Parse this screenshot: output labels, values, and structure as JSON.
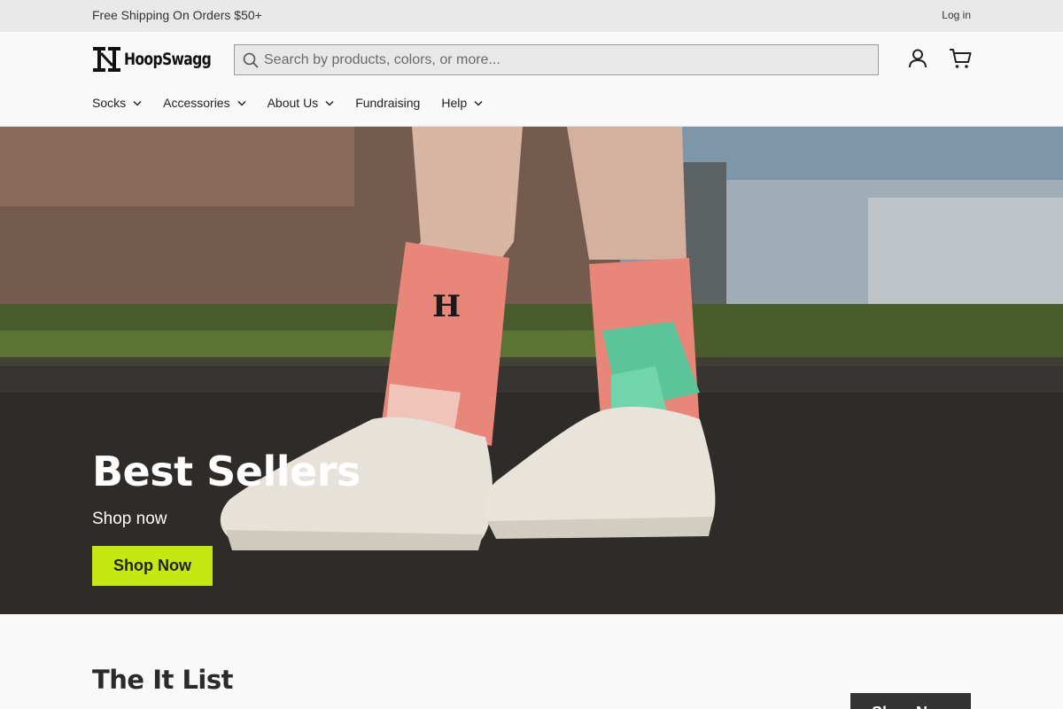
{
  "announcement": {
    "promo_text": "Free Shipping On Orders $50+",
    "login_label": "Log in"
  },
  "header": {
    "logo_text": "HoopSwagg",
    "search": {
      "placeholder": "Search by products, colors, or more...",
      "value": ""
    },
    "icons": [
      "search-icon",
      "account-icon",
      "cart-icon"
    ]
  },
  "nav": {
    "items": [
      {
        "label": "Socks",
        "has_dropdown": true
      },
      {
        "label": "Accessories",
        "has_dropdown": true
      },
      {
        "label": "About Us",
        "has_dropdown": true
      },
      {
        "label": "Fundraising",
        "has_dropdown": false
      },
      {
        "label": "Help",
        "has_dropdown": true
      }
    ]
  },
  "hero": {
    "title": "Best Sellers",
    "subtitle": "Shop now",
    "button_label": "Shop Now"
  },
  "it_list": {
    "title": "The It List",
    "button_label": "Shop Now"
  },
  "colors": {
    "accent": "#c5e812",
    "announcement_bg": "#e9e9e9",
    "page_bg": "#f9f9f9",
    "dark_button": "#333333"
  }
}
